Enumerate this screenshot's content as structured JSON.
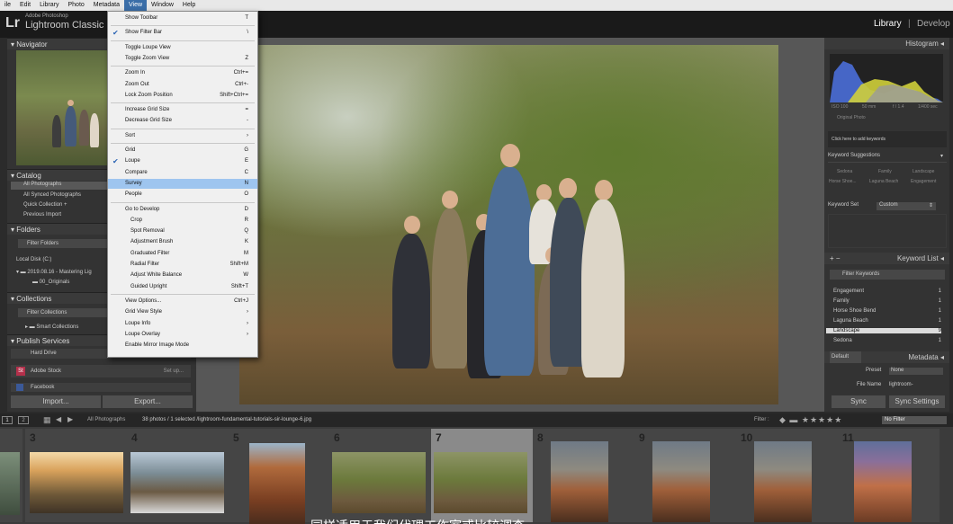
{
  "menubar": [
    "ile",
    "Edit",
    "Library",
    "Photo",
    "Metadata",
    "View",
    "Window",
    "Help"
  ],
  "identity": {
    "logo": "Lr",
    "small": "Adobe Photoshop",
    "name": "Lightroom Classic",
    "library": "Library",
    "sep": "|",
    "develop": "Develop"
  },
  "left": {
    "navigator": "Navigator",
    "catalog": "Catalog",
    "catalog_items": [
      "All Photographs",
      "All Synced Photographs",
      "Quick Collection +",
      "Previous Import"
    ],
    "folders": "Folders",
    "filter_folders": "Filter Folders",
    "local_disk": "Local Disk (C:)",
    "folder1": "2019.08.16 - Mastering Lig",
    "folder2": "00_Originals",
    "collections": "Collections",
    "filter_collections": "Filter Collections",
    "smart_collections": "Smart Collections",
    "publish": "Publish Services",
    "hard_drive": "Hard Drive",
    "adobe_stock": "Adobe Stock",
    "set_up": "Set up...",
    "facebook": "Facebook",
    "import_btn": "Import...",
    "export_btn": "Export..."
  },
  "right": {
    "histogram": "Histogram",
    "iso": "ISO 100",
    "mm": "50 mm",
    "fstop": "f / 1.4",
    "shutter": "1/400 sec",
    "original_photo": "Original Photo",
    "add_keywords": "Click here to add keywords",
    "kw_suggestions": "Keyword Suggestions",
    "suggestions": [
      "Sedona",
      "Family",
      "Landscape",
      "Horse Shoe...",
      "Laguna Beach",
      "Engagement"
    ],
    "keyword_set": "Keyword Set",
    "custom": "Custom",
    "keyword_list": "Keyword List",
    "filter_keywords": "Filter Keywords",
    "keywords": [
      {
        "name": "Engagement",
        "count": "1"
      },
      {
        "name": "Family",
        "count": "1"
      },
      {
        "name": "Horse Shoe Bend",
        "count": "1"
      },
      {
        "name": "Laguna Beach",
        "count": "1"
      },
      {
        "name": "Landscape",
        "count": "9"
      },
      {
        "name": "Sedona",
        "count": "1"
      }
    ],
    "metadata": "Metadata",
    "default": "Default",
    "preset": "Preset",
    "preset_val": "None",
    "file_name": "File Name",
    "file_name_val": "lightroom-",
    "sync": "Sync",
    "sync_settings": "Sync Settings"
  },
  "menu": [
    {
      "label": "Show Toolbar",
      "sc": "T"
    },
    {
      "label": "Show Filter Bar",
      "sc": "\\",
      "checked": true
    },
    {
      "label": "Toggle Loupe View",
      "sc": ""
    },
    {
      "label": "Toggle Zoom View",
      "sc": "Z"
    },
    {
      "label": "Zoom In",
      "sc": "Ctrl+="
    },
    {
      "label": "Zoom Out",
      "sc": "Ctrl+-"
    },
    {
      "label": "Lock Zoom Position",
      "sc": "Shift+Ctrl+="
    },
    {
      "label": "Increase Grid Size",
      "sc": "="
    },
    {
      "label": "Decrease Grid Size",
      "sc": "-"
    },
    {
      "label": "Sort",
      "sc": "›"
    },
    {
      "label": "Grid",
      "sc": "G"
    },
    {
      "label": "Loupe",
      "sc": "E",
      "checked": true
    },
    {
      "label": "Compare",
      "sc": "C"
    },
    {
      "label": "Survey",
      "sc": "N",
      "highlight": true
    },
    {
      "label": "People",
      "sc": "O"
    },
    {
      "label": "Go to Develop",
      "sc": "D"
    },
    {
      "label": "Crop",
      "sc": "R",
      "indent": true
    },
    {
      "label": "Spot Removal",
      "sc": "Q",
      "indent": true
    },
    {
      "label": "Adjustment Brush",
      "sc": "K",
      "indent": true
    },
    {
      "label": "Graduated Filter",
      "sc": "M",
      "indent": true
    },
    {
      "label": "Radial Filter",
      "sc": "Shift+M",
      "indent": true
    },
    {
      "label": "Adjust White Balance",
      "sc": "W",
      "indent": true
    },
    {
      "label": "Guided Upright",
      "sc": "Shift+T",
      "indent": true
    },
    {
      "label": "View Options...",
      "sc": "Ctrl+J"
    },
    {
      "label": "Grid View Style",
      "sc": "›"
    },
    {
      "label": "Loupe Info",
      "sc": "›"
    },
    {
      "label": "Loupe Overlay",
      "sc": "›"
    },
    {
      "label": "Enable Mirror Image Mode",
      "sc": ""
    }
  ],
  "filmbar": {
    "btn1": "1",
    "btn2": "2",
    "source": "All Photographs",
    "count": "38 photos / 1 selected /lightroom-fundamental-tutorials-sir-lounge-6.jpg",
    "filter": "Filter :",
    "no_filter": "No Filter"
  },
  "film_numbers": [
    "3",
    "4",
    "5",
    "6",
    "7",
    "8",
    "9",
    "10",
    "11"
  ],
  "subtitle": "同样适用于我们代理工作室或比较调查"
}
